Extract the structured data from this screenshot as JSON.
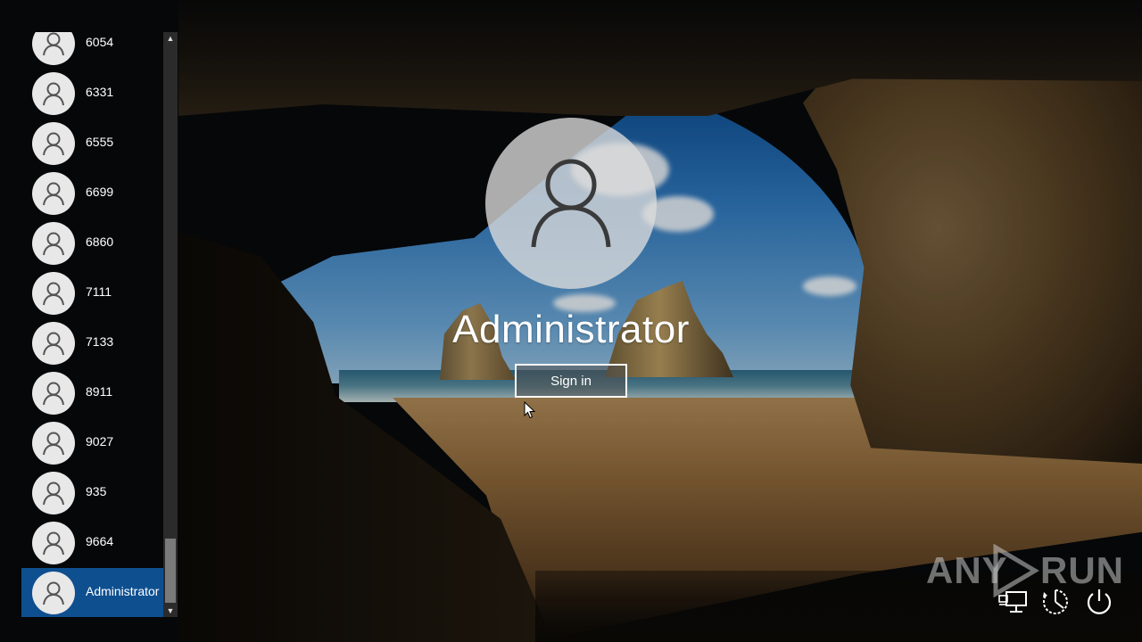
{
  "users": [
    {
      "label": "6054"
    },
    {
      "label": "6331"
    },
    {
      "label": "6555"
    },
    {
      "label": "6699"
    },
    {
      "label": "6860"
    },
    {
      "label": "7111"
    },
    {
      "label": "7133"
    },
    {
      "label": "8911"
    },
    {
      "label": "9027"
    },
    {
      "label": "935"
    },
    {
      "label": "9664"
    },
    {
      "label": "Administrator",
      "selected": true
    }
  ],
  "signin": {
    "username": "Administrator",
    "button_label": "Sign in"
  },
  "watermark": {
    "left": "ANY",
    "right": "RUN"
  },
  "icons": {
    "avatar": "user-silhouette-icon",
    "network": "network-icon",
    "accessibility": "ease-of-access-icon",
    "power": "power-icon"
  },
  "colors": {
    "selected_bg": "#0e4f90",
    "avatar_bg": "#e8e8e8"
  }
}
